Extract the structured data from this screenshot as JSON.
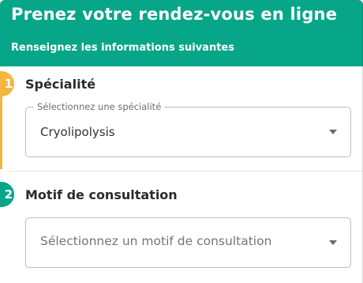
{
  "header": {
    "title": "Prenez votre rendez-vous en ligne",
    "subtitle": "Renseignez les informations suivantes"
  },
  "steps": [
    {
      "number": "1",
      "status": "done",
      "color": "#f4b63f",
      "title": "Spécialité",
      "field": {
        "label": "Sélectionnez une spécialité",
        "value": "Cryolipolysis"
      }
    },
    {
      "number": "2",
      "status": "active",
      "color": "#08a688",
      "title": "Motif de consultation",
      "field": {
        "placeholder": "Sélectionnez un motif de consultation",
        "value": ""
      }
    }
  ],
  "colors": {
    "brand": "#08a688",
    "step_done": "#f4b63f",
    "text": "#2b2b2b"
  },
  "icons": {
    "dropdown": "caret-down-icon"
  }
}
